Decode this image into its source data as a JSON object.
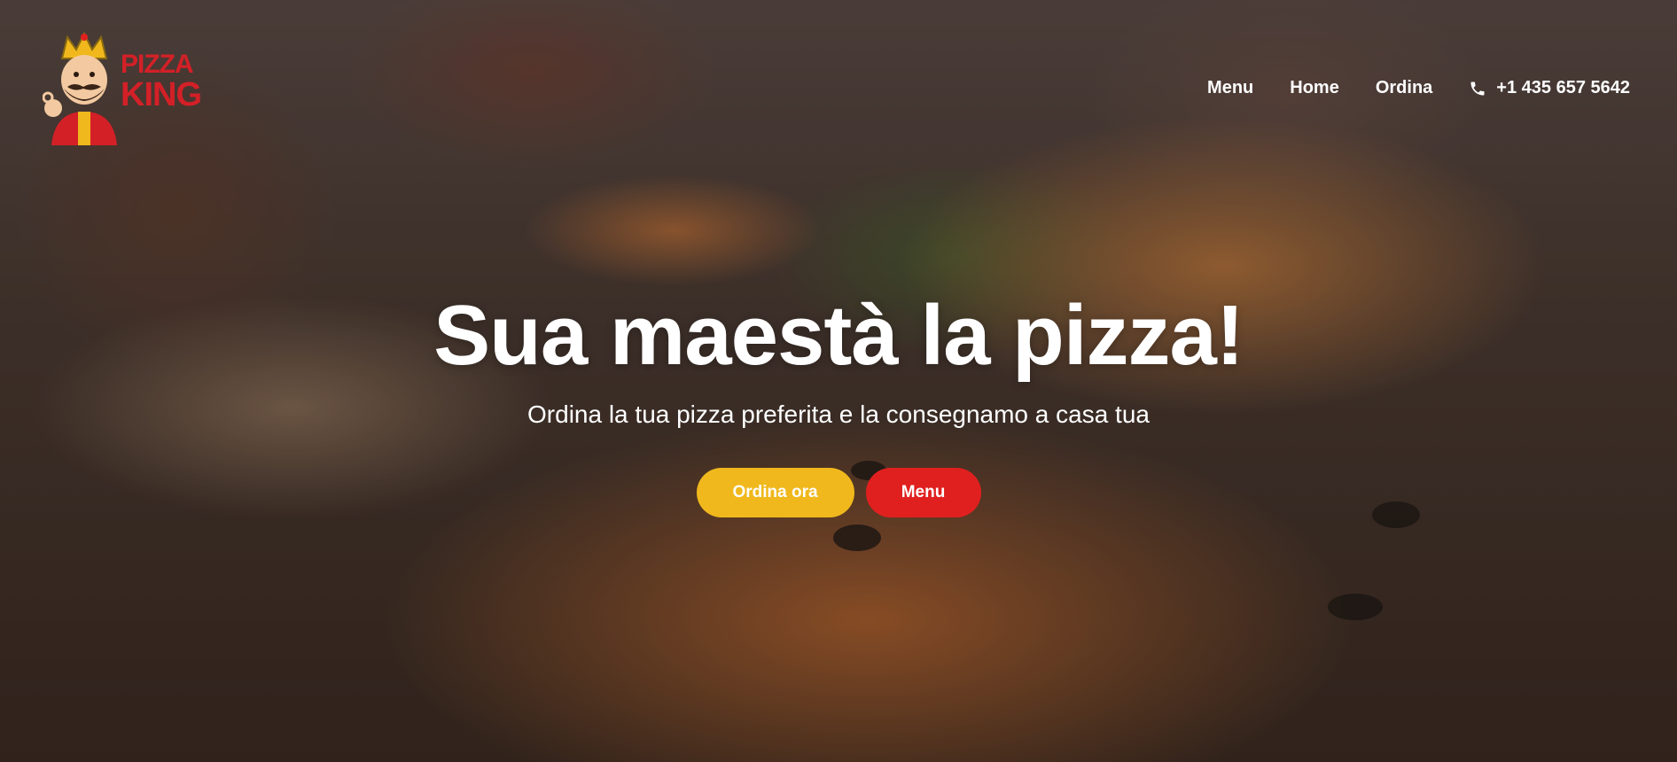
{
  "brand": {
    "logo_line1": "PIZZA",
    "logo_line2": "KING",
    "red": "#d32027",
    "gold": "#f0b81c"
  },
  "nav": {
    "items": [
      {
        "label": "Menu"
      },
      {
        "label": "Home"
      },
      {
        "label": "Ordina"
      }
    ],
    "phone": {
      "icon": "phone-icon",
      "label": "+1 435 657 5642"
    }
  },
  "hero": {
    "title": "Sua maestà la pizza!",
    "subtitle": "Ordina la tua pizza preferita e la consegnamo a casa tua",
    "background": "pizza-table-photo"
  },
  "cta": {
    "primary_label": "Ordina ora",
    "primary_color": "#f0b81c",
    "secondary_label": "Menu",
    "secondary_color": "#e0201f"
  }
}
